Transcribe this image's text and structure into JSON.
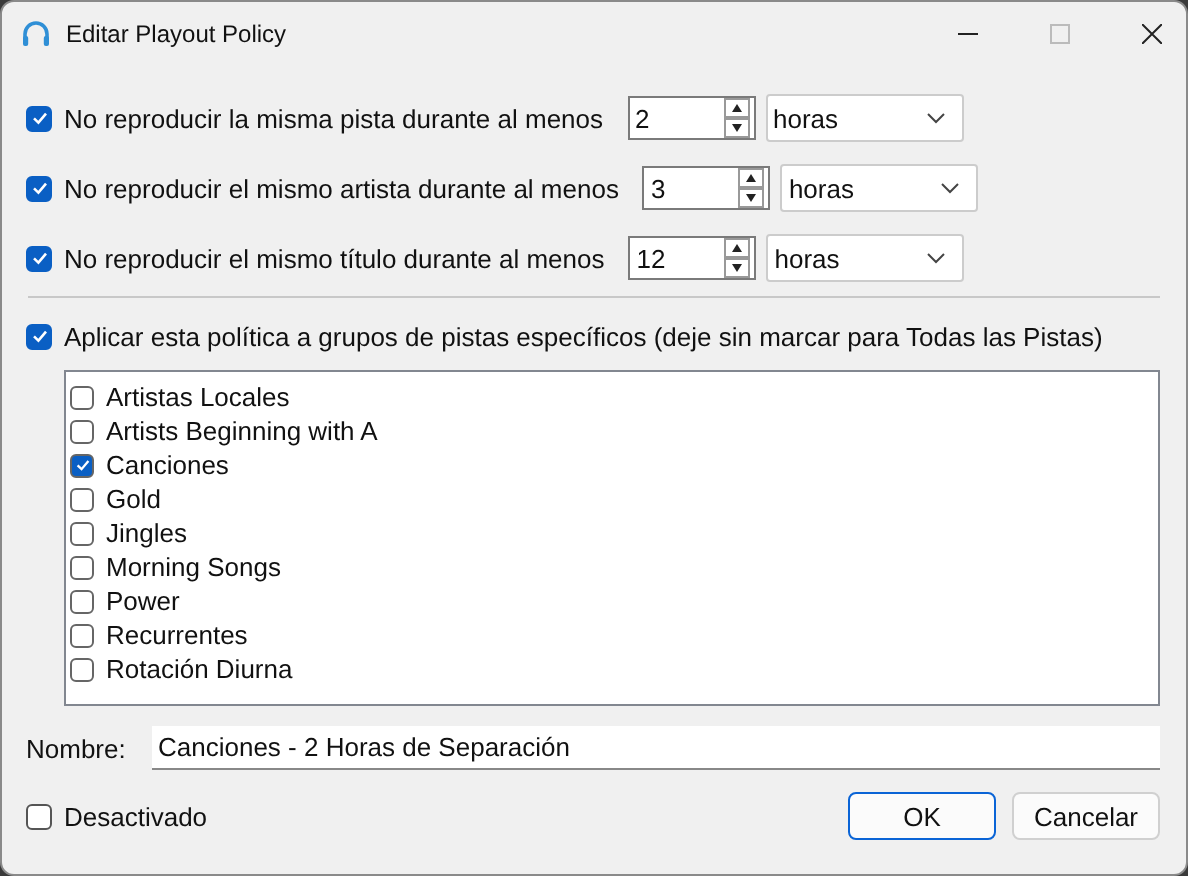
{
  "window": {
    "title": "Editar Playout Policy"
  },
  "rules": [
    {
      "label": "No reproducir la misma pista durante al menos",
      "checked": true,
      "value": "2",
      "unit": "horas"
    },
    {
      "label": "No reproducir el mismo artista durante al menos",
      "checked": true,
      "value": "3",
      "unit": "horas"
    },
    {
      "label": "No reproducir el mismo título durante al menos",
      "checked": true,
      "value": "12",
      "unit": "horas"
    }
  ],
  "apply_groups": {
    "label": "Aplicar esta política a grupos de pistas específicos (deje sin marcar para Todas las Pistas)",
    "checked": true
  },
  "groups": [
    {
      "label": "Artistas Locales",
      "checked": false
    },
    {
      "label": "Artists Beginning with A",
      "checked": false
    },
    {
      "label": "Canciones",
      "checked": true
    },
    {
      "label": "Gold",
      "checked": false
    },
    {
      "label": "Jingles",
      "checked": false
    },
    {
      "label": "Morning Songs",
      "checked": false
    },
    {
      "label": "Power",
      "checked": false
    },
    {
      "label": "Recurrentes",
      "checked": false
    },
    {
      "label": "Rotación Diurna",
      "checked": false
    }
  ],
  "name": {
    "label": "Nombre:",
    "value": "Canciones - 2 Horas de Separación"
  },
  "disabled": {
    "label": "Desactivado",
    "checked": false
  },
  "buttons": [
    "OK",
    "Cancelar"
  ]
}
